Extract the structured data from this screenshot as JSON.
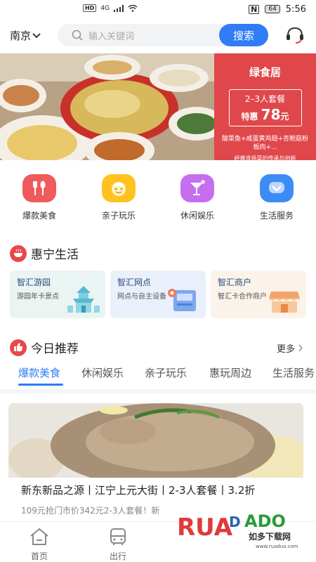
{
  "status": {
    "time": "5:56",
    "network": "4G",
    "hd": "HD",
    "battery": "64",
    "nfc": "N"
  },
  "header": {
    "city": "南京",
    "search_placeholder": "输入关键词",
    "search_button": "搜索"
  },
  "banner": {
    "title": "绿食居",
    "deal_line1": "2–3人套餐",
    "deal_prefix": "特惠",
    "deal_price": "78",
    "deal_unit": "元",
    "desc": "酸菜鱼+咸蛋黄鸡翅+杏鲍菇粉板肉+...",
    "tagline": "经典淮扬菜的传承与创新"
  },
  "categories": [
    {
      "label": "爆款美食",
      "icon": "fork-spoon-icon",
      "color": "#f05a5a"
    },
    {
      "label": "亲子玩乐",
      "icon": "child-face-icon",
      "color": "#ffc21f"
    },
    {
      "label": "休闲娱乐",
      "icon": "cocktail-icon",
      "color": "#c66ef0"
    },
    {
      "label": "生活服务",
      "icon": "heart-chat-icon",
      "color": "#3d8cf5"
    }
  ],
  "section_life": {
    "title": "惠宁生活"
  },
  "service_cards": [
    {
      "title": "智汇游园",
      "subtitle": "游园年卡景点",
      "bg": "#eaf5f3"
    },
    {
      "title": "智汇网点",
      "subtitle": "网点与自主设备",
      "bg": "#eaf0fb"
    },
    {
      "title": "智汇商户",
      "subtitle": "智汇卡合作商户",
      "bg": "#fbf3ea"
    }
  ],
  "section_recommend": {
    "title": "今日推荐",
    "more": "更多"
  },
  "tabs": [
    "爆款美食",
    "休闲娱乐",
    "亲子玩乐",
    "惠玩周边",
    "生活服务"
  ],
  "deal": {
    "title": "新东新品之源丨江宁上元大街丨2-3人套餐丨3.2折",
    "desc": "109元抢门市价342元2-3人套餐！新"
  },
  "bottom_nav": [
    {
      "label": "首页",
      "icon": "home-icon"
    },
    {
      "label": "出行",
      "icon": "bus-icon"
    }
  ],
  "watermark": {
    "brand": "RUANDADO",
    "sub": "如多下载网",
    "url": "www.ruaduo.com"
  }
}
